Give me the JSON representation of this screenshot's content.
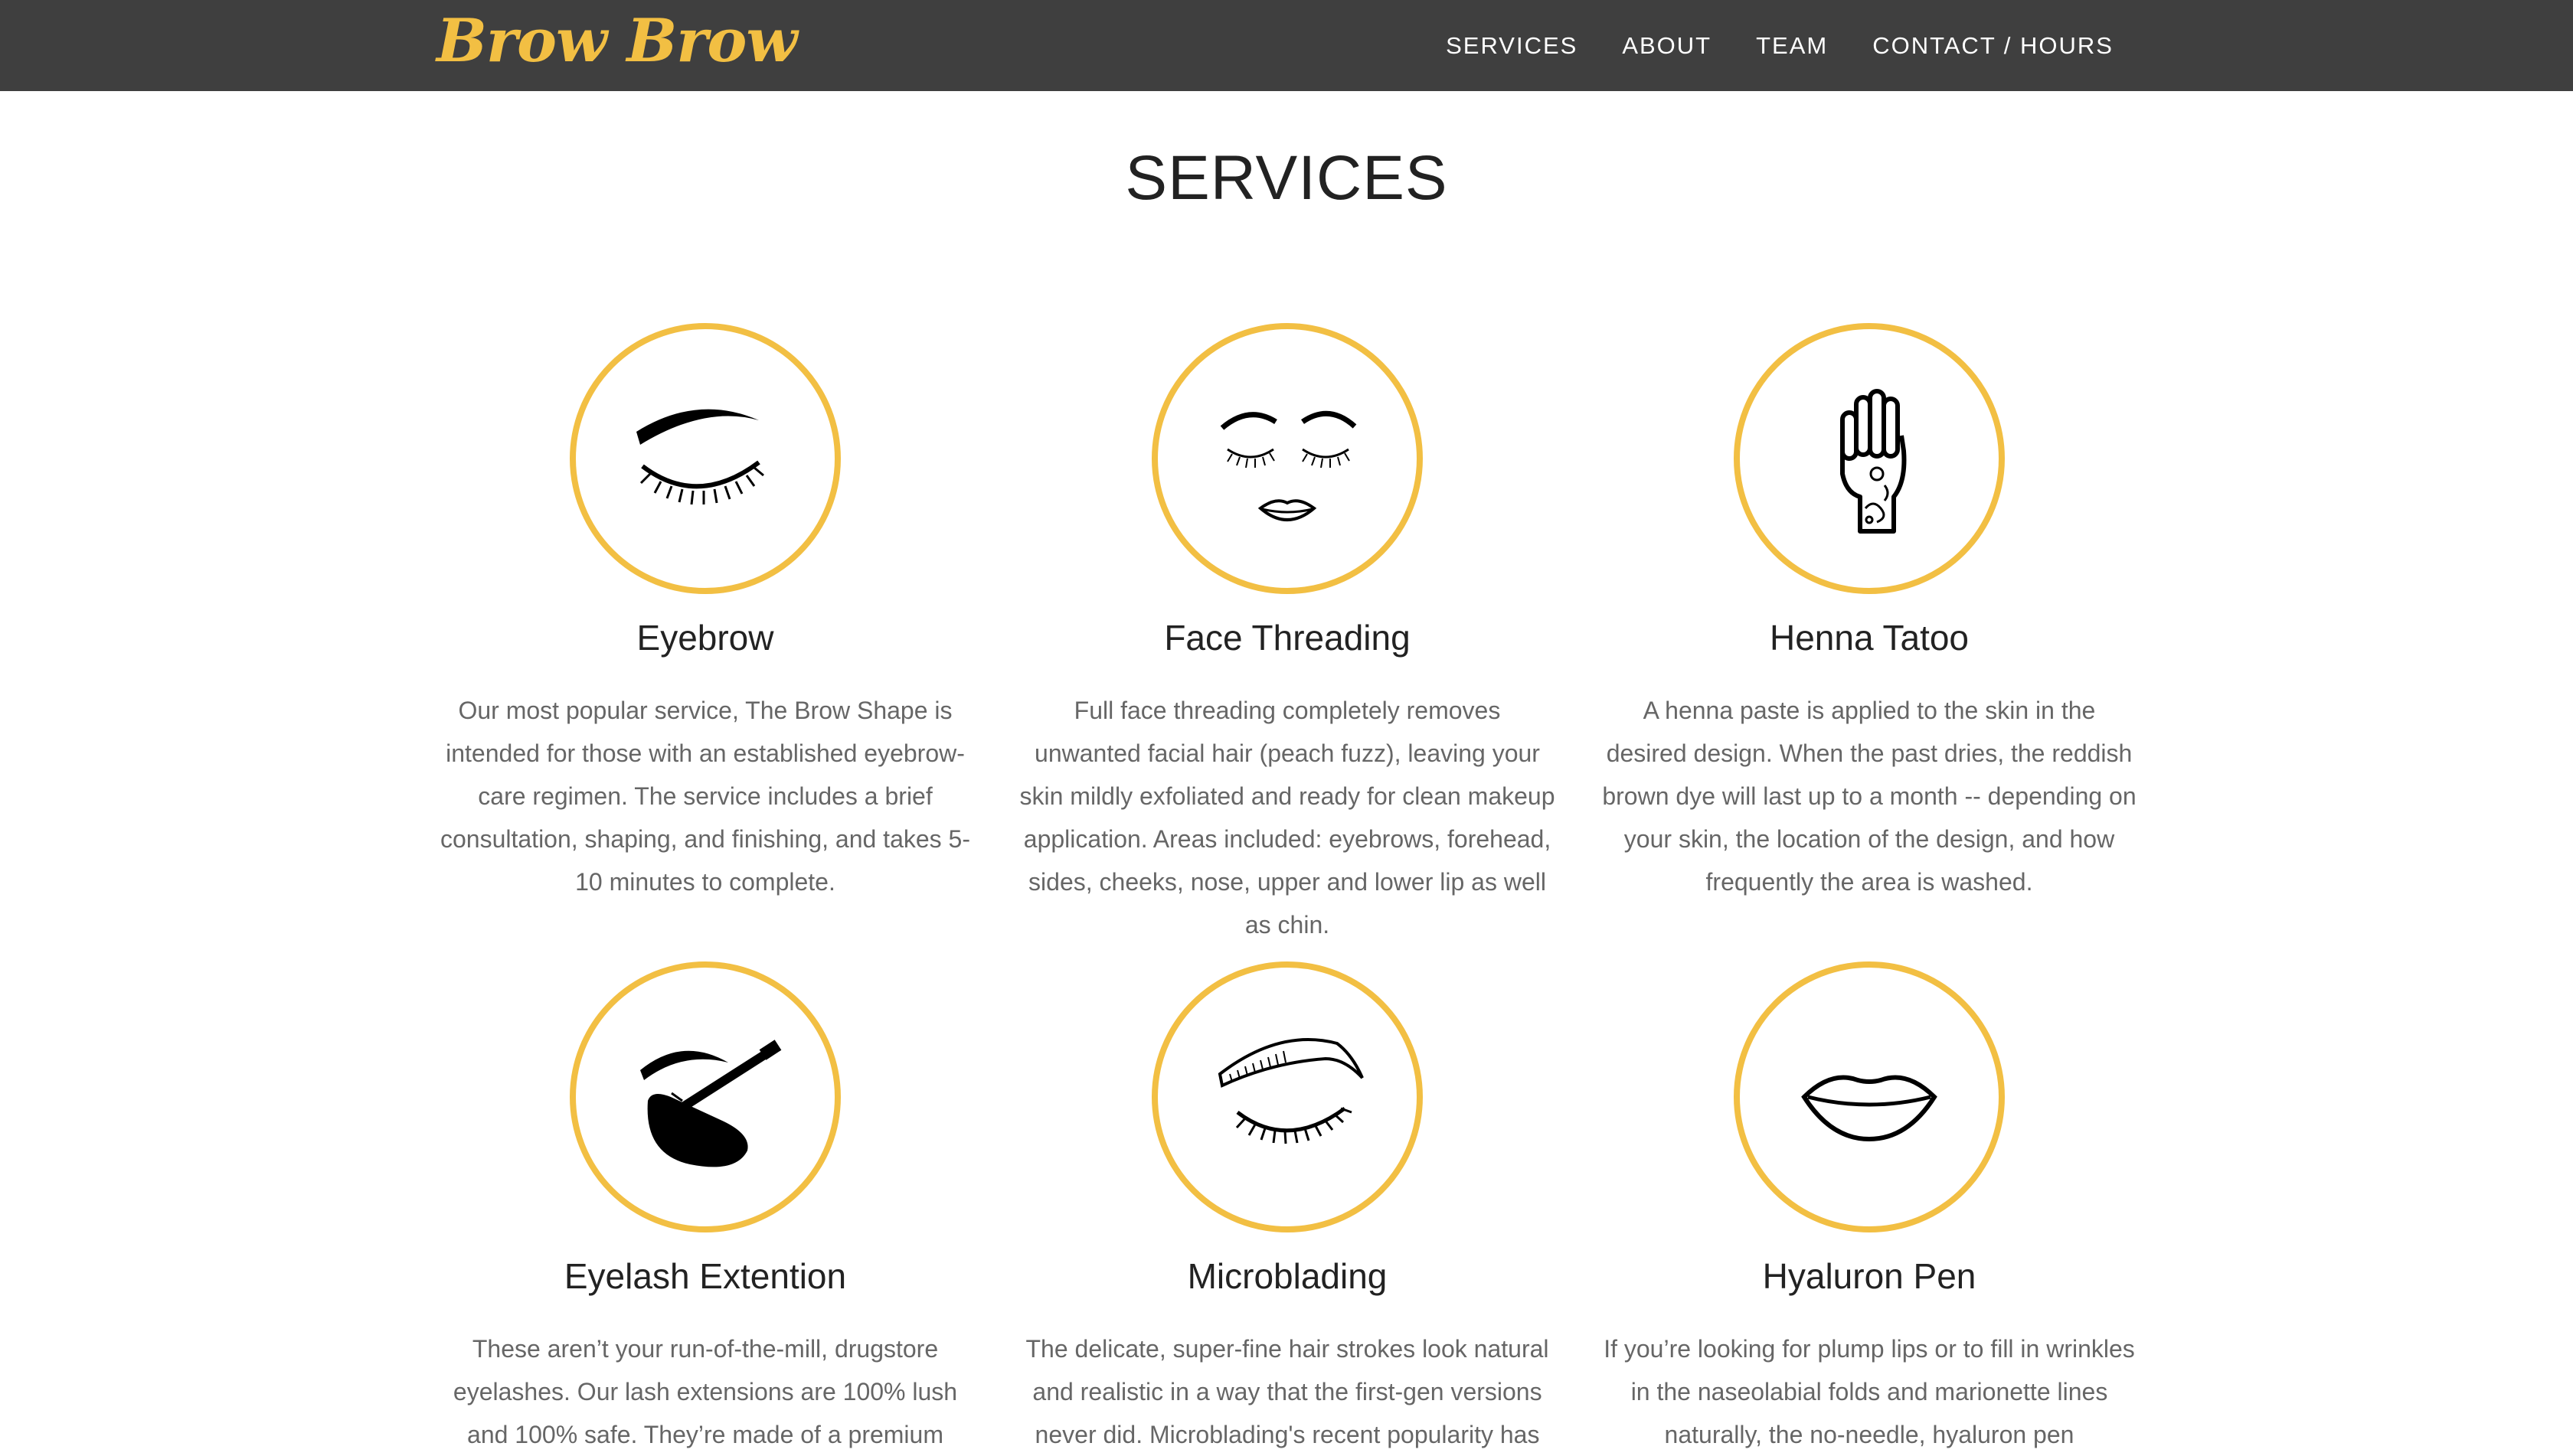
{
  "brand": {
    "name": "Brow Brow",
    "color": "#f2bf43"
  },
  "nav": {
    "items": [
      {
        "label": "SERVICES"
      },
      {
        "label": "ABOUT"
      },
      {
        "label": "TEAM"
      },
      {
        "label": "CONTACT / HOURS"
      }
    ]
  },
  "services": {
    "title": "SERVICES",
    "items": [
      {
        "title": "Eyebrow",
        "icon": "eyebrow-icon",
        "description": "Our most popular service, The Brow Shape is intended for those with an established eyebrow-care regimen. The service includes a brief consultation, shaping, and finishing, and takes 5-10 minutes to complete."
      },
      {
        "title": "Face Threading",
        "icon": "face-icon",
        "description": "Full face threading completely removes unwanted facial hair (peach fuzz), leaving your skin mildly exfoliated and ready for clean makeup application. Areas included: eyebrows, forehead, sides, cheeks, nose, upper and lower lip as well as chin."
      },
      {
        "title": "Henna Tatoo",
        "icon": "henna-hand-icon",
        "description": "A henna paste is applied to the skin in the desired design. When the past dries, the reddish brown dye will last up to a month -- depending on your skin, the location of the design, and how frequently the area is washed."
      },
      {
        "title": "Eyelash Extention",
        "icon": "eyelash-extension-icon",
        "description": "These aren’t your run-of-the-mill, drugstore eyelashes. Our lash extensions are 100% lush and 100% safe. They’re made of a premium"
      },
      {
        "title": "Microblading",
        "icon": "microblading-icon",
        "description": "The delicate, super-fine hair strokes look natural and realistic in a way that the first-gen versions never did. Microblading's recent popularity has"
      },
      {
        "title": "Hyaluron Pen",
        "icon": "lips-icon",
        "description": "If you’re looking for plump lips or to fill in wrinkles in the naseolabial folds and marionette lines naturally, the no-needle, hyaluron pen"
      }
    ]
  }
}
